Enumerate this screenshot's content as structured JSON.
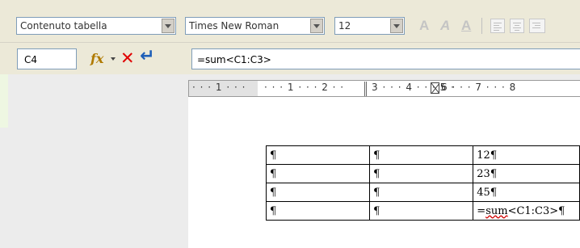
{
  "toolbar": {
    "paragraph_style": "Contenuto tabella",
    "font_name": "Times New Roman",
    "font_size": "12",
    "bold_label": "A",
    "italic_label": "A",
    "underline_label": "A"
  },
  "formula_bar": {
    "cell_reference": "C4",
    "function_icon": "fx-icon",
    "cancel_icon": "cancel-icon",
    "accept_icon": "accept-icon",
    "formula": "=sum<C1:C3>"
  },
  "ruler": {
    "segments": [
      "· · · 1 · · ·",
      "· · · 1 · · · 2 · ·",
      "3 · · · 4 · · · 5 ·",
      "6 · · · 7 · · · 8"
    ]
  },
  "document_table": {
    "rows": [
      [
        "¶",
        "¶",
        "12¶"
      ],
      [
        "¶",
        "¶",
        "23¶"
      ],
      [
        "¶",
        "¶",
        "45¶"
      ],
      [
        "¶",
        "¶",
        "=sum<C1:C3>¶"
      ]
    ],
    "last_formula_prefix": "=",
    "last_formula_fn": "sum",
    "last_formula_rest": "<C1:C3>¶"
  }
}
